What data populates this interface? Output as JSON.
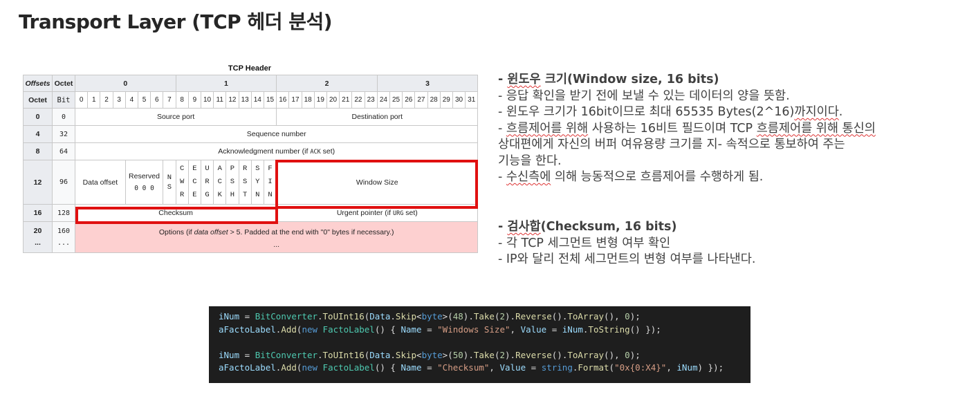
{
  "title": "Transport Layer (TCP 헤더 분석)",
  "table": {
    "caption": "TCP Header",
    "offsets_label": "Offsets",
    "octet_label": "Octet",
    "bit_label": "Bit",
    "octet_heads": [
      "0",
      "1",
      "2",
      "3"
    ],
    "bits": [
      "0",
      "1",
      "2",
      "3",
      "4",
      "5",
      "6",
      "7",
      "8",
      "9",
      "10",
      "11",
      "12",
      "13",
      "14",
      "15",
      "16",
      "17",
      "18",
      "19",
      "20",
      "21",
      "22",
      "23",
      "24",
      "25",
      "26",
      "27",
      "28",
      "29",
      "30",
      "31"
    ],
    "rows": [
      {
        "octet": "0",
        "bit": "0"
      },
      {
        "octet": "4",
        "bit": "32"
      },
      {
        "octet": "8",
        "bit": "64"
      },
      {
        "octet": "12",
        "bit": "96"
      },
      {
        "octet": "16",
        "bit": "128"
      },
      {
        "octet": "20",
        "octet2": "...",
        "bit": "160",
        "bit2": "..."
      }
    ],
    "source_port": "Source port",
    "destination_port": "Destination port",
    "sequence_number": "Sequence number",
    "ack_number": "Acknowledgment number (if ACK set)",
    "data_offset": "Data offset",
    "reserved": "Reserved",
    "reserved_bits": "0 0 0",
    "ns_flag": "N S",
    "flags": [
      {
        "l1": "C",
        "l2": "W",
        "l3": "R"
      },
      {
        "l1": "E",
        "l2": "C",
        "l3": "E"
      },
      {
        "l1": "U",
        "l2": "R",
        "l3": "G"
      },
      {
        "l1": "A",
        "l2": "C",
        "l3": "K"
      },
      {
        "l1": "P",
        "l2": "S",
        "l3": "H"
      },
      {
        "l1": "R",
        "l2": "S",
        "l3": "T"
      },
      {
        "l1": "S",
        "l2": "Y",
        "l3": "N"
      },
      {
        "l1": "F",
        "l2": "I",
        "l3": "N"
      }
    ],
    "window_size": "Window Size",
    "checksum": "Checksum",
    "urgent_pointer": "Urgent pointer (if URG set)",
    "options_line1": "Options (if data offset > 5. Padded at the end with \"0\" bytes if necessary.)",
    "options_line2": "..."
  },
  "notes_window": {
    "heading": "- 윈도우 크기(Window size, 16 bits)",
    "lines": [
      "- 응답 확인을 받기 전에 보낼 수 있는 데이터의 양을 뜻함.",
      "- 윈도우 크기가 16bit이므로 최대 65535 Bytes(2^16)까지이다.",
      "-  흐름제어를 위해 사용하는 16비트 필드이며 TCP 흐름제어를 위해 통신의",
      "상대편에게 자신의 버퍼 여유용량 크기를 지- 속적으로 통보하여 주는",
      "기능을 한다.",
      "- 수신측에 의해 능동적으로 흐름제어를 수행하게 됨."
    ]
  },
  "notes_checksum": {
    "heading": "- 검사합(Checksum, 16 bits)",
    "lines": [
      "- 각 TCP 세그먼트 변형 여부 확인",
      "- IP와 달리 전체 세그먼트의 변형 여부를 나타낸다."
    ]
  },
  "code_lines": [
    "iNum = BitConverter.ToUInt16(Data.Skip<byte>(48).Take(2).Reverse().ToArray(), 0);",
    "aFactoLabel.Add(new FactoLabel() { Name = \"Windows Size\", Value = iNum.ToString() });",
    "",
    "iNum = BitConverter.ToUInt16(Data.Skip<byte>(50).Take(2).Reverse().ToArray(), 0);",
    "aFactoLabel.Add(new FactoLabel() { Name = \"Checksum\", Value = string.Format(\"0x{0:X4}\", iNum) });"
  ],
  "colors": {
    "highlight_box": "#e01010",
    "options_fill": "#fdd0d0",
    "header_fill": "#eaecf0",
    "code_background": "#1e1e1e"
  }
}
